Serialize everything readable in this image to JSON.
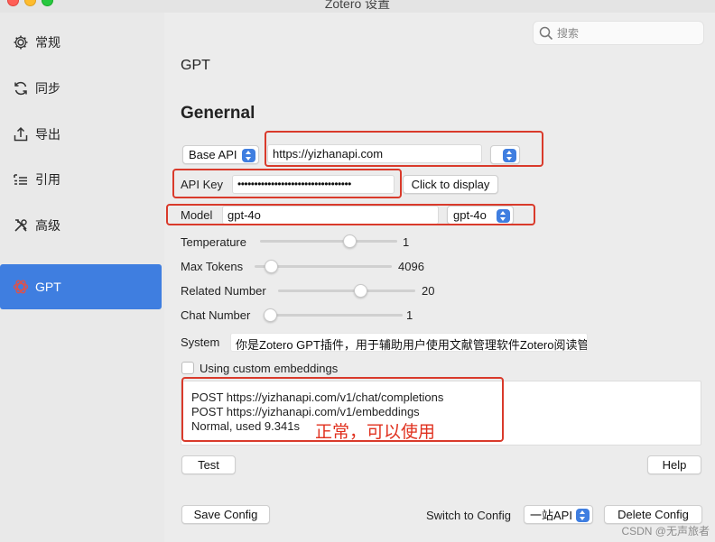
{
  "window": {
    "title": "Zotero 设置"
  },
  "sidebar": {
    "items": [
      {
        "label": "常规",
        "icon": "gear-icon"
      },
      {
        "label": "同步",
        "icon": "sync-icon"
      },
      {
        "label": "导出",
        "icon": "export-icon"
      },
      {
        "label": "引用",
        "icon": "cite-icon"
      },
      {
        "label": "高级",
        "icon": "tools-icon"
      },
      {
        "label": "GPT",
        "icon": "openai-icon",
        "active": true
      }
    ]
  },
  "search": {
    "placeholder": "搜索"
  },
  "pane": {
    "title": "GPT",
    "section": "Genernal"
  },
  "form": {
    "base_api": {
      "selector": "Base API",
      "value": "https://yizhanapi.com"
    },
    "api_key": {
      "label": "API Key",
      "value": "••••••••••••••••••••••••••••••••••",
      "display_button": "Click to display"
    },
    "model": {
      "label": "Model",
      "value": "gpt-4o",
      "select": "gpt-4o"
    },
    "temperature": {
      "label": "Temperature",
      "value": "1",
      "level": 0.65
    },
    "max_tokens": {
      "label": "Max Tokens",
      "value": "4096",
      "level": 0.12
    },
    "related_number": {
      "label": "Related Number",
      "value": "20",
      "level": 0.6
    },
    "chat_number": {
      "label": "Chat Number",
      "value": "1",
      "level": 0.03
    },
    "system": {
      "label": "System",
      "value": "你是Zotero GPT插件，用于辅助用户使用文献管理软件Zotero阅读管"
    },
    "embeddings": {
      "label": "Using custom embeddings",
      "checked": false
    }
  },
  "response": {
    "lines": [
      "POST https://yizhanapi.com/v1/chat/completions",
      "POST https://yizhanapi.com/v1/embeddings",
      "Normal, used 9.341s"
    ],
    "annotation": "正常，可以使用"
  },
  "buttons": {
    "test": "Test",
    "help": "Help",
    "save_config": "Save Config",
    "delete_config": "Delete Config"
  },
  "config": {
    "switch_label": "Switch to Config",
    "selected": "一站API"
  },
  "watermark": "CSDN @无声旅者",
  "colors": {
    "accent": "#3f7ee0",
    "annotation_red": "#d93a2b"
  }
}
